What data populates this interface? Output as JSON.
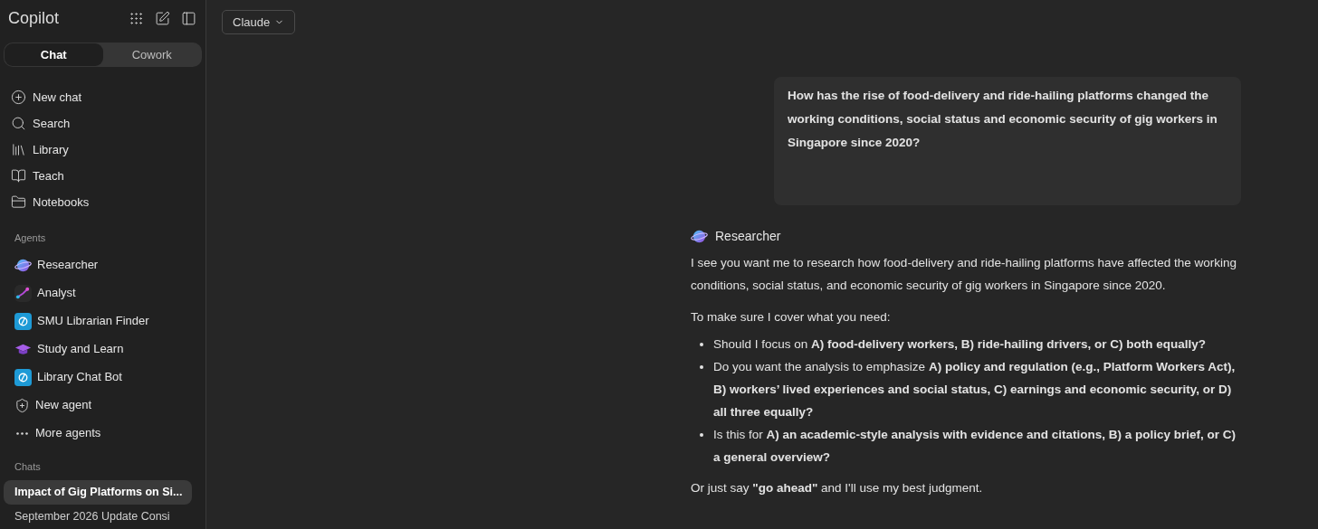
{
  "sidebar": {
    "app_title": "Copilot",
    "mode_tabs": [
      {
        "label": "Chat",
        "selected": true
      },
      {
        "label": "Cowork",
        "selected": false
      }
    ],
    "nav": [
      {
        "label": "New chat",
        "kind": "new"
      },
      {
        "label": "Search",
        "kind": "search"
      },
      {
        "label": "Library",
        "kind": "library"
      },
      {
        "label": "Teach",
        "kind": "teach"
      },
      {
        "label": "Notebooks",
        "kind": "notebooks"
      }
    ],
    "agents_heading": "Agents",
    "agents": [
      {
        "label": "Researcher",
        "kind": "researcher"
      },
      {
        "label": "Analyst",
        "kind": "analyst"
      },
      {
        "label": "SMU Librarian Finder",
        "kind": "custom"
      },
      {
        "label": "Study and Learn",
        "kind": "tutor"
      },
      {
        "label": "Library Chat Bot",
        "kind": "custom"
      },
      {
        "label": "New agent",
        "kind": "create"
      },
      {
        "label": "More agents",
        "kind": "more"
      }
    ],
    "chats_heading": "Chats",
    "chats": [
      {
        "label": "Impact of Gig Platforms on Si...",
        "selected": true
      },
      {
        "label": "September 2026 Update Consi",
        "selected": false
      }
    ]
  },
  "model_picker": "Claude",
  "user_message": "How has the rise of food-delivery and ride-hailing platforms changed the working conditions, social status and economic security of gig workers in Singapore since 2020?",
  "response": {
    "agent": "Researcher",
    "intro": "I see you want me to research how food-delivery and ride-hailing platforms have affected the working conditions, social status, and economic security of gig workers in Singapore since 2020.",
    "lead": "To make sure I cover what you need:",
    "bullets": [
      "Should I focus on **A) food-delivery workers, B) ride-hailing drivers, or C) both equally?**",
      "Do you want the analysis to emphasize **A) policy and regulation (e.g., Platform Workers Act), B) workers’ lived experiences and social status, C) earnings and economic security, or D) all three equally?**",
      "Is this for **A) an academic-style analysis with evidence and citations, B) a policy brief, or C) a general overview?**"
    ],
    "closing": "Or just say **\"go ahead\"** and I'll use my best judgment."
  }
}
